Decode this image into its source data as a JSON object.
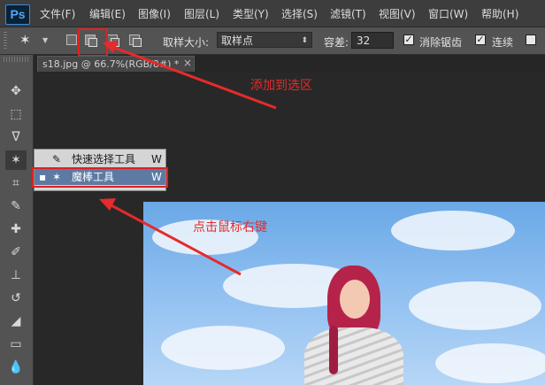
{
  "app": {
    "logo": "Ps"
  },
  "menu": [
    "文件(F)",
    "编辑(E)",
    "图像(I)",
    "图层(L)",
    "类型(Y)",
    "选择(S)",
    "滤镜(T)",
    "视图(V)",
    "窗口(W)",
    "帮助(H)"
  ],
  "options": {
    "sample_size_label": "取样大小:",
    "sample_size_value": "取样点",
    "tolerance_label": "容差:",
    "tolerance_value": "32",
    "antialias_label": "消除锯齿",
    "contiguous_label": "连续",
    "antialias_checked": true,
    "contiguous_checked": true
  },
  "document": {
    "tab_title": "s18.jpg @ 66.7%(RGB/8#) *",
    "close": "×"
  },
  "context_menu": {
    "items": [
      {
        "label": "快速选择工具",
        "shortcut": "W",
        "selected": false
      },
      {
        "label": "魔棒工具",
        "shortcut": "W",
        "selected": true
      }
    ]
  },
  "annotations": {
    "add_to_selection": "添加到选区",
    "right_click": "点击鼠标右键"
  },
  "colors": {
    "annotation": "#e52b2b",
    "menu_selected": "#5d7aa3"
  }
}
